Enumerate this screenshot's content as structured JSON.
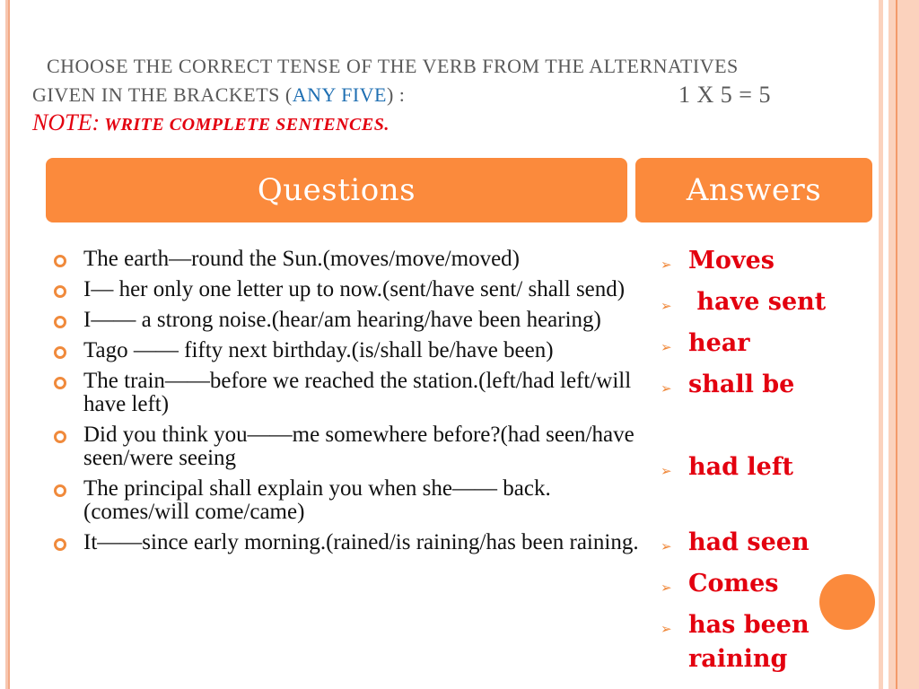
{
  "title": {
    "line1": "CHOOSE THE CORRECT TENSE OF THE VERB FROM THE ALTERNATIVES",
    "line2_prefix": "GIVEN IN THE BRACKETS (",
    "line2_accent": "ANY FIVE",
    "line2_suffix": ") :",
    "score": "1 X 5   = 5"
  },
  "note": {
    "label": "NOTE:",
    "text": " WRITE COMPLETE SENTENCES."
  },
  "headers": {
    "questions": "Questions",
    "answers": "Answers"
  },
  "questions": [
    "The earth—round the Sun.(moves/move/moved)",
    "I— her only one letter up to now.(sent/have sent/ shall send)",
    "I—— a strong noise.(hear/am hearing/have been hearing)",
    "Tago —— fifty next birthday.(is/shall be/have been)",
    "The train——before we reached the station.(left/had left/will have left)",
    "Did you think you——me somewhere before?(had seen/have seen/were seeing",
    "The principal shall explain you when she—— back.(comes/will come/came)",
    "It——since early morning.(rained/is raining/has been raining."
  ],
  "answers": [
    "Moves",
    " have sent",
    "hear",
    "shall be",
    "had left",
    "had seen",
    "Comes",
    "has been raining"
  ],
  "colors": {
    "accent_orange": "#fb8a3c",
    "answer_red": "#e3000f",
    "title_gray": "#595959",
    "link_blue": "#1f6fb2"
  }
}
